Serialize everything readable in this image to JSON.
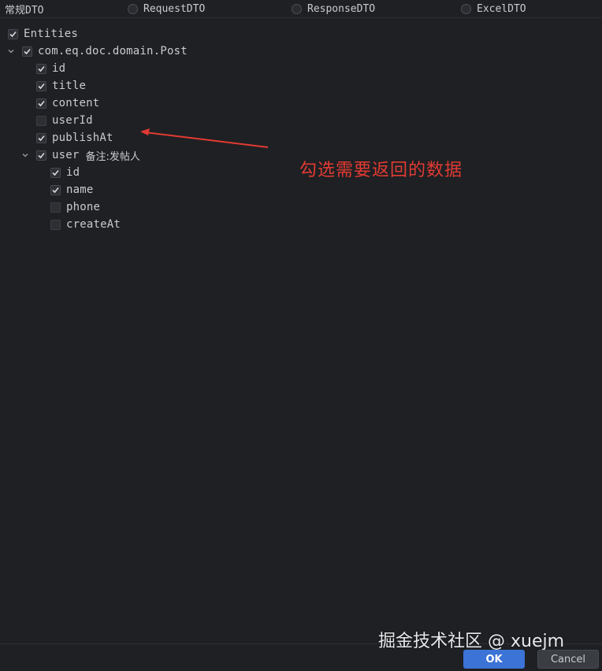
{
  "dto_types": [
    {
      "label": "常规DTO",
      "selected": true
    },
    {
      "label": "RequestDTO",
      "selected": false
    },
    {
      "label": "ResponseDTO",
      "selected": false
    },
    {
      "label": "ExcelDTO",
      "selected": false
    }
  ],
  "tree": {
    "root": {
      "label": "Entities",
      "checked": true
    },
    "entity": {
      "label": "com.eq.doc.domain.Post",
      "checked": true,
      "expanded": true
    },
    "fields": [
      {
        "label": "id",
        "checked": true
      },
      {
        "label": "title",
        "checked": true
      },
      {
        "label": "content",
        "checked": true
      },
      {
        "label": "userId",
        "checked": false
      },
      {
        "label": "publishAt",
        "checked": true
      }
    ],
    "relation": {
      "label": "user",
      "note": "备注:发帖人",
      "checked": true,
      "expanded": true
    },
    "relation_fields": [
      {
        "label": "id",
        "checked": true
      },
      {
        "label": "name",
        "checked": true
      },
      {
        "label": "phone",
        "checked": false
      },
      {
        "label": "createAt",
        "checked": false
      }
    ]
  },
  "annotation": {
    "text": "勾选需要返回的数据",
    "color": "#e23a33"
  },
  "watermark": "掘金技术社区 @ xuejm",
  "buttons": {
    "ok": "OK",
    "cancel": "Cancel"
  },
  "colors": {
    "background": "#1f2023",
    "accent": "#3b73d6"
  }
}
